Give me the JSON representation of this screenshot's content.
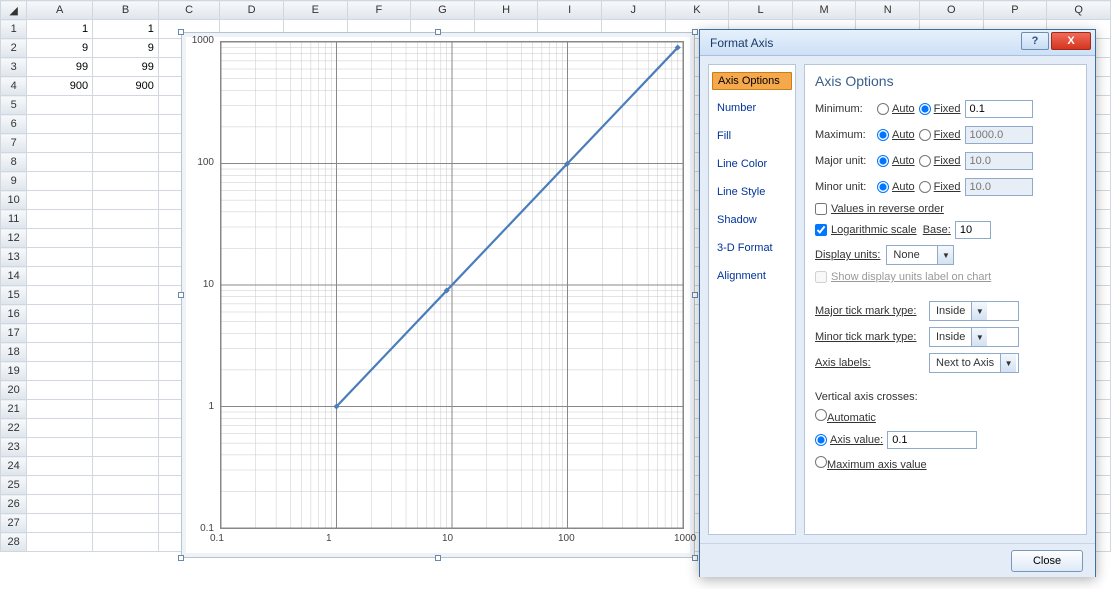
{
  "spreadsheet": {
    "columns": [
      "A",
      "B",
      "C",
      "D",
      "E",
      "F",
      "G",
      "H",
      "I",
      "J",
      "K",
      "L",
      "M",
      "N",
      "O",
      "P",
      "Q"
    ],
    "rows": 28,
    "cells": {
      "A1": "1",
      "B1": "1",
      "A2": "9",
      "B2": "9",
      "A3": "99",
      "B3": "99",
      "A4": "900",
      "B4": "900"
    }
  },
  "chart_data": {
    "type": "line",
    "x": [
      1,
      9,
      99,
      900
    ],
    "y": [
      1,
      9,
      99,
      900
    ],
    "xscale": "log",
    "yscale": "log",
    "xlim": [
      0.1,
      1000
    ],
    "ylim": [
      0.1,
      1000
    ],
    "xticks": [
      0.1,
      1,
      10,
      100,
      1000
    ],
    "yticks": [
      0.1,
      1,
      10,
      100,
      1000
    ],
    "xticklabels": [
      "0.1",
      "1",
      "10",
      "100",
      "1000"
    ],
    "yticklabels": [
      "0.1",
      "1",
      "10",
      "100",
      "1000"
    ]
  },
  "dialog": {
    "title": "Format Axis",
    "side": {
      "items": [
        "Axis Options",
        "Number",
        "Fill",
        "Line Color",
        "Line Style",
        "Shadow",
        "3-D Format",
        "Alignment"
      ],
      "active": 0
    },
    "heading": "Axis Options",
    "min_label": "Minimum:",
    "max_label": "Maximum:",
    "major_label": "Major unit:",
    "minor_label": "Minor unit:",
    "auto": "Auto",
    "fixed": "Fixed",
    "min_val": "0.1",
    "max_val": "1000.0",
    "major_val": "10.0",
    "minor_val": "10.0",
    "reverse": "Values in reverse order",
    "logscale": "Logarithmic scale",
    "base_label": "Base:",
    "base_val": "10",
    "display_units": "Display units:",
    "display_units_val": "None",
    "show_units": "Show display units label on chart",
    "major_tick": "Major tick mark type:",
    "major_tick_val": "Inside",
    "minor_tick": "Minor tick mark type:",
    "minor_tick_val": "Inside",
    "axis_labels": "Axis labels:",
    "axis_labels_val": "Next to Axis",
    "cross_heading": "Vertical axis crosses:",
    "cross_auto": "Automatic",
    "cross_val_label": "Axis value:",
    "cross_val": "0.1",
    "cross_max": "Maximum axis value",
    "close_btn": "Close",
    "help": "?",
    "x": "X"
  }
}
